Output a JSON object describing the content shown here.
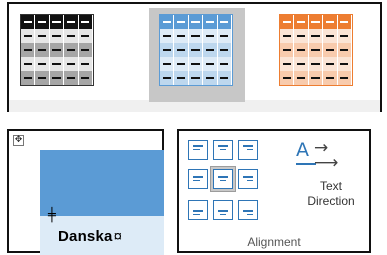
{
  "table_styles": {
    "items": [
      {
        "name": "dark",
        "accent": "#111111",
        "selected": false
      },
      {
        "name": "blue",
        "accent": "#5b9bd5",
        "selected": true
      },
      {
        "name": "orange",
        "accent": "#ed7d31",
        "selected": false
      }
    ]
  },
  "document": {
    "cell_text": "Danska",
    "header_color": "#5b9bd5",
    "body_color": "#ddebf7",
    "move_handle_icon": "four-way-arrow-icon",
    "cursor_icon": "row-resize-cursor-icon"
  },
  "alignment": {
    "buttons": [
      {
        "name": "align-top-left"
      },
      {
        "name": "align-top-center"
      },
      {
        "name": "align-top-right"
      },
      {
        "name": "align-center-left"
      },
      {
        "name": "align-center-center",
        "selected": true
      },
      {
        "name": "align-center-right"
      },
      {
        "name": "align-bottom-left"
      },
      {
        "name": "align-bottom-center"
      },
      {
        "name": "align-bottom-right"
      }
    ],
    "text_direction_line1": "Text",
    "text_direction_line2": "Direction",
    "group_label": "Alignment",
    "accent": "#2e75b6"
  }
}
